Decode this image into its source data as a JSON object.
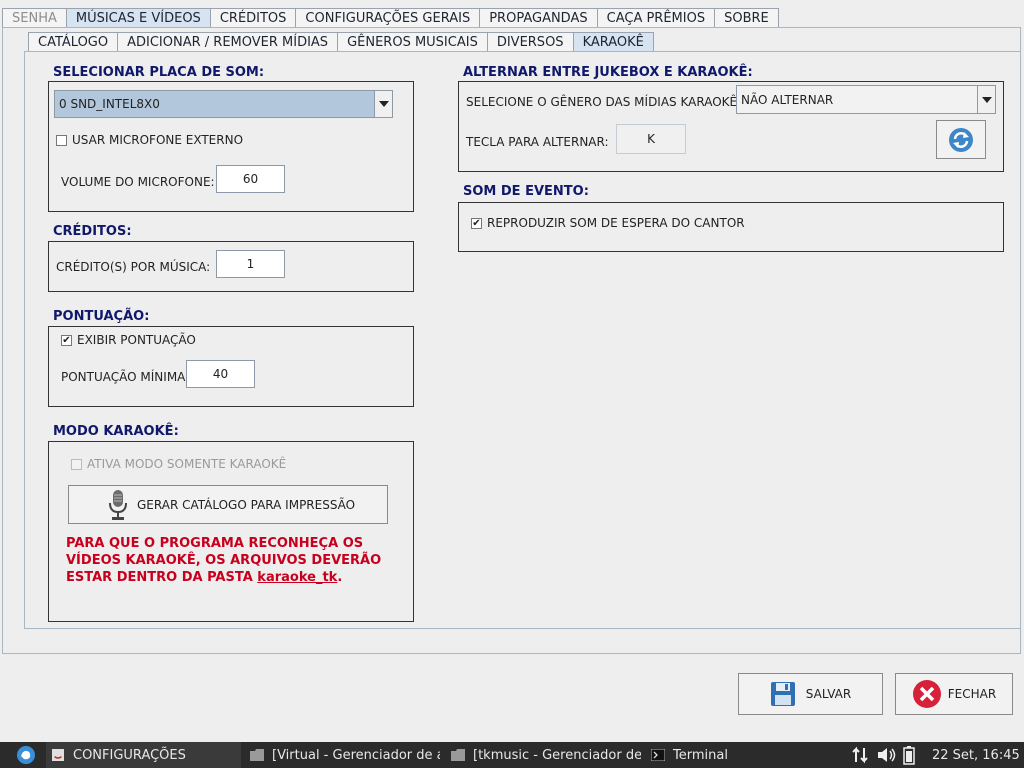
{
  "main_tabs": [
    {
      "label": "SENHA",
      "state": "disabled"
    },
    {
      "label": "MÚSICAS E VÍDEOS",
      "state": "active"
    },
    {
      "label": "CRÉDITOS",
      "state": ""
    },
    {
      "label": "CONFIGURAÇÕES GERAIS",
      "state": ""
    },
    {
      "label": "PROPAGANDAS",
      "state": ""
    },
    {
      "label": "CAÇA PRÊMIOS",
      "state": ""
    },
    {
      "label": "SOBRE",
      "state": ""
    }
  ],
  "sub_tabs": [
    {
      "label": "CATÁLOGO",
      "state": ""
    },
    {
      "label": "ADICIONAR / REMOVER MÍDIAS",
      "state": ""
    },
    {
      "label": "GÊNEROS MUSICAIS",
      "state": ""
    },
    {
      "label": "DIVERSOS",
      "state": ""
    },
    {
      "label": "KARAOKÊ",
      "state": "active"
    }
  ],
  "sound_card": {
    "title": "SELECIONAR PLACA DE SOM:",
    "selected": "0 SND_INTEL8X0",
    "external_mic_label": "USAR MICROFONE EXTERNO",
    "external_mic_checked": false,
    "mic_volume_label": "VOLUME DO MICROFONE:",
    "mic_volume_value": "60"
  },
  "credits": {
    "title": "CRÉDITOS:",
    "per_song_label": "CRÉDITO(S) POR MÚSICA:",
    "per_song_value": "1"
  },
  "score": {
    "title": "PONTUAÇÃO:",
    "show_label": "EXIBIR PONTUAÇÃO",
    "show_checked": true,
    "min_label": "PONTUAÇÃO MÍNIMA:",
    "min_value": "40"
  },
  "karaoke_mode": {
    "title": "MODO KARAOKÊ:",
    "only_karaoke_label": "ATIVA MODO SOMENTE KARAOKÊ",
    "only_karaoke_checked": false,
    "catalog_button": "GERAR CATÁLOGO PARA IMPRESSÃO",
    "warning_text": "PARA QUE O PROGRAMA RECONHEÇA OS VÍDEOS KARAOKÊ, OS ARQUIVOS DEVERÃO ESTAR DENTRO DA PASTA",
    "warning_folder": "karaoke_tk",
    "warning_end": "."
  },
  "switch": {
    "title": "ALTERNAR ENTRE JUKEBOX E KARAOKÊ:",
    "genre_label": "SELECIONE O GÊNERO DAS MÍDIAS KARAOKÊ:",
    "genre_selected": "NÃO ALTERNAR",
    "key_label": "TECLA PARA ALTERNAR:",
    "key_value": "K"
  },
  "event_sound": {
    "title": "SOM DE EVENTO:",
    "wait_sound_label": "REPRODUZIR SOM DE ESPERA DO CANTOR",
    "wait_sound_checked": true
  },
  "actions": {
    "save": "SALVAR",
    "close": "FECHAR"
  },
  "taskbar": {
    "items": [
      "CONFIGURAÇÕES",
      "[Virtual - Gerenciador de ar...",
      "[tkmusic - Gerenciador de ...",
      "Terminal"
    ],
    "clock": "22 Set, 16:45"
  },
  "colors": {
    "title_blue": "#10186a",
    "warning_red": "#c8001e",
    "active_tab": "#d6e3f1",
    "combo_selected": "#b3c7dc"
  }
}
